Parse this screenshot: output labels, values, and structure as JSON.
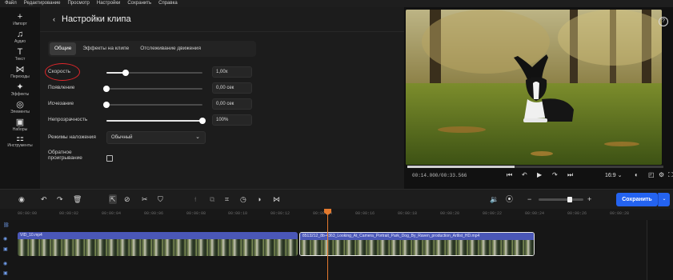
{
  "menu": [
    "Файл",
    "Редактирование",
    "Просмотр",
    "Настройки",
    "Сохранить",
    "Справка"
  ],
  "rail": [
    {
      "icon": "plus-icon",
      "glyph": "+",
      "label": "Импорт"
    },
    {
      "icon": "music-icon",
      "glyph": "♫",
      "label": "Аудио"
    },
    {
      "icon": "text-icon",
      "glyph": "T",
      "label": "Текст"
    },
    {
      "icon": "transitions-icon",
      "glyph": "⋈",
      "label": "Переходы"
    },
    {
      "icon": "effects-icon",
      "glyph": "✦",
      "label": "Эффекты"
    },
    {
      "icon": "elements-icon",
      "glyph": "◎",
      "label": "Элементы"
    },
    {
      "icon": "sets-icon",
      "glyph": "▣",
      "label": "Наборы"
    },
    {
      "icon": "tools-icon",
      "glyph": "⚏",
      "label": "Инструменты"
    }
  ],
  "panel": {
    "title": "Настройки клипа",
    "tabs": [
      "Общие",
      "Эффекты на клипе",
      "Отслеживание движения"
    ],
    "speed": {
      "label": "Скорость",
      "value": "1,00x",
      "level": 0.2
    },
    "fade_in": {
      "label": "Появление",
      "value": "0,00 сек",
      "level": 0
    },
    "fade_out": {
      "label": "Исчезание",
      "value": "0,00 сек",
      "level": 0
    },
    "opacity": {
      "label": "Непрозрачность",
      "value": "100%",
      "level": 1
    },
    "blend": {
      "label": "Режимы наложения",
      "value": "Обычный"
    },
    "reverse": {
      "label_line1": "Обратное",
      "label_line2": "проигрывание",
      "checked": false
    }
  },
  "preview": {
    "timecode": "00:14.000/00:33.566",
    "aspect": "16:9",
    "progress": 0.42,
    "help": "?"
  },
  "toolbar": {
    "save_label": "Сохранить"
  },
  "ruler": [
    "00:00:00",
    "00:00:02",
    "00:00:04",
    "00:00:06",
    "00:00:08",
    "00:00:10",
    "00:00:12",
    "00:00:14",
    "00:00:16",
    "00:00:18",
    "00:00:20",
    "00:00:22",
    "00:00:24",
    "00:00:26",
    "00:00:28"
  ],
  "clips": [
    {
      "name": "VID_10.mp4"
    },
    {
      "name": "8513212_8b-4363_Looking_At_Camera_Portrait_Park_Dog_By_Raven_production_Artlist_HD.mp4"
    }
  ],
  "colors": {
    "accent": "#2463f0",
    "playhead": "#e47a2e",
    "clip": "#4a57b7",
    "annotation": "#e0262a"
  }
}
